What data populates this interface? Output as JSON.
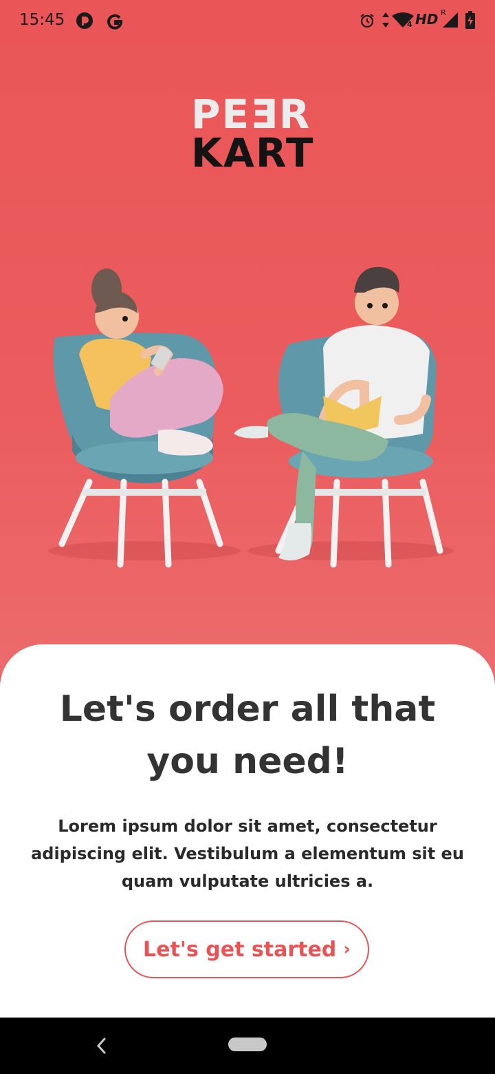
{
  "status_bar": {
    "time": "15:45",
    "icons": [
      "app-circle-icon",
      "google-g-icon",
      "alarm-icon",
      "data-arrows-icon",
      "wifi-icon",
      "hd-icon",
      "signal-icon",
      "battery-charging-icon"
    ],
    "hd_label": "HD",
    "roaming_label": "R",
    "wifi_badge": "4"
  },
  "logo": {
    "line1": "PEƎR",
    "line2": "KART",
    "colors": {
      "line1": "#ececec",
      "line2": "#141414"
    }
  },
  "illustration": {
    "icon": "people-sitting-in-chairs-illustration"
  },
  "onboarding": {
    "headline": "Let's order all that you need!",
    "body": "Lorem ipsum dolor sit amet, consectetur adipiscing elit. Vestibulum a elementum sit eu quam vulputate ultricies a.",
    "cta_label": "Let's get started",
    "cta_chevron": "›"
  },
  "theme": {
    "accent": "#e85456",
    "hero_background": "#ea5657",
    "sheet_background": "#ffffff",
    "text_dark": "#333333"
  },
  "nav_bar": {
    "icons": [
      "back-icon",
      "home-pill-icon"
    ]
  }
}
